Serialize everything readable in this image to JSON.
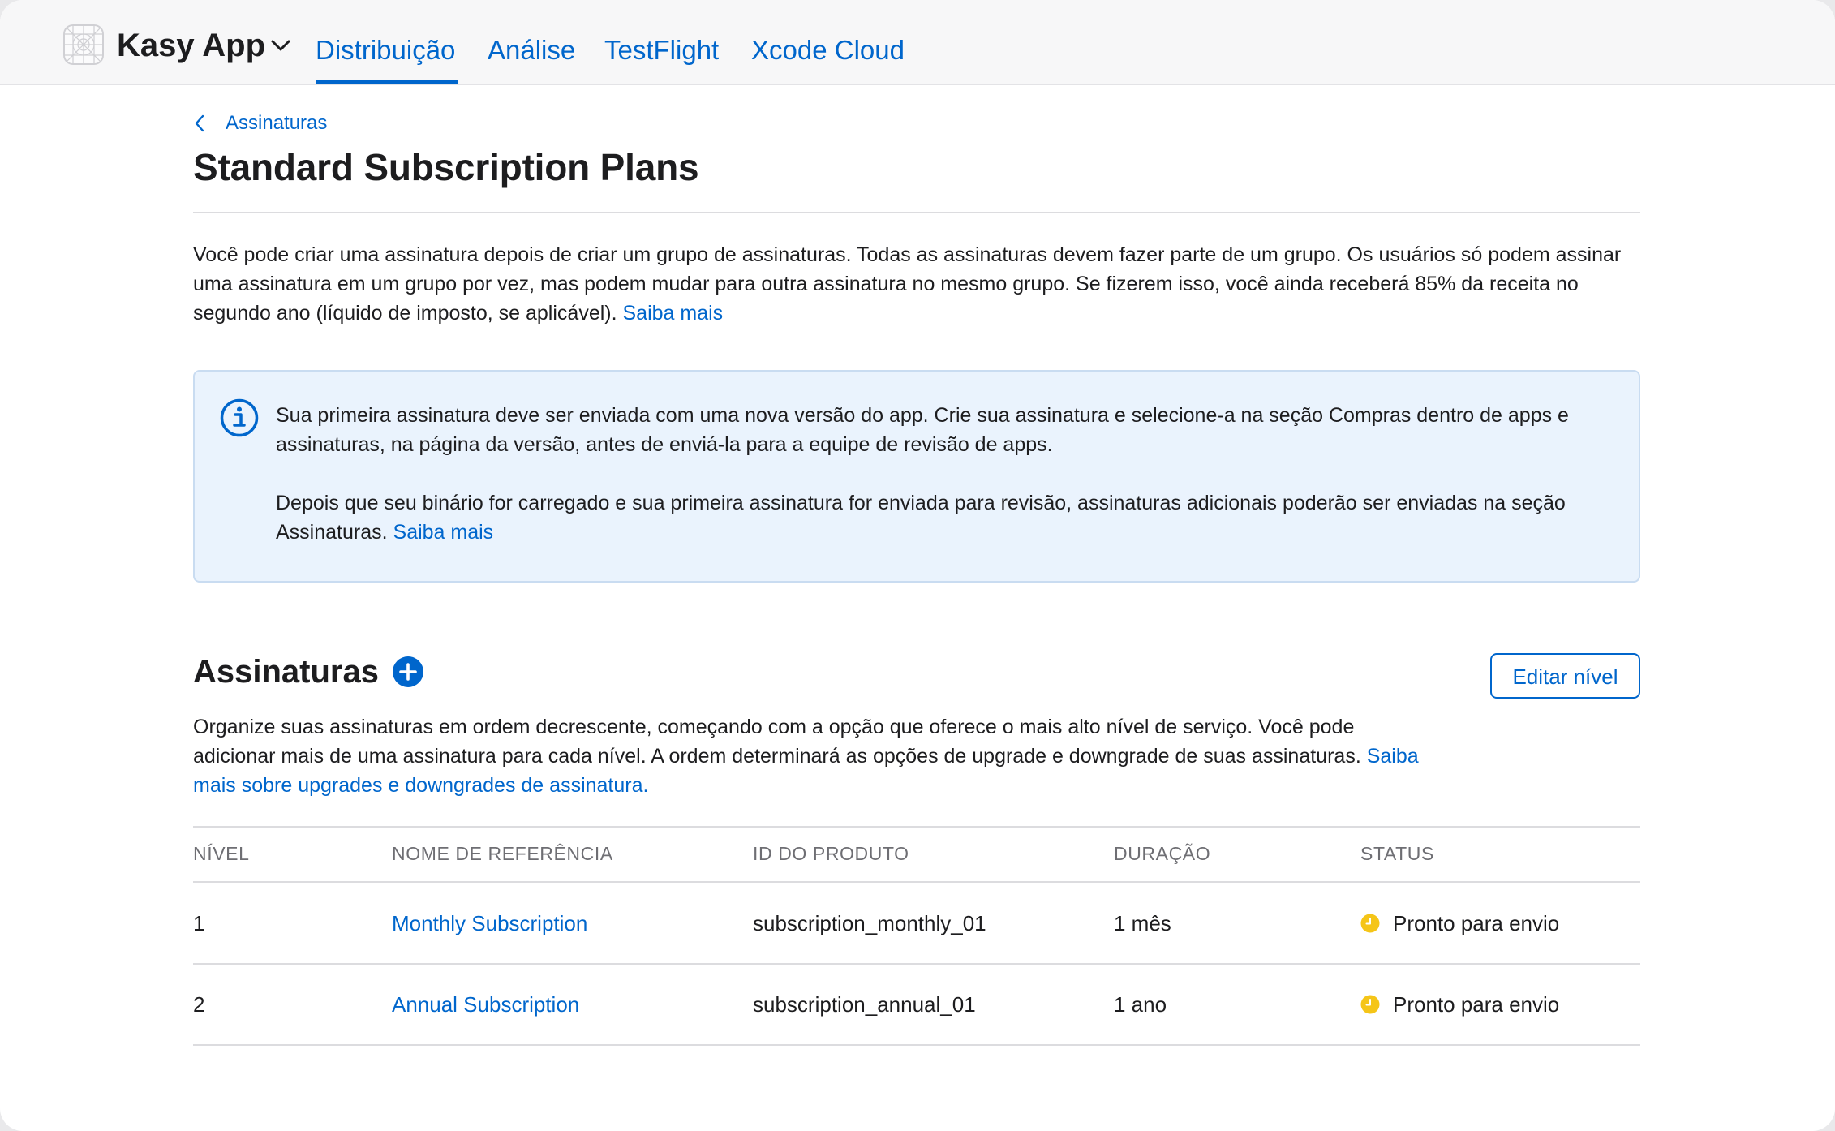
{
  "header": {
    "app_name": "Kasy App",
    "tabs": [
      {
        "label": "Distribuição",
        "active": true
      },
      {
        "label": "Análise",
        "active": false
      },
      {
        "label": "TestFlight",
        "active": false
      },
      {
        "label": "Xcode Cloud",
        "active": false
      }
    ]
  },
  "breadcrumb": {
    "label": "Assinaturas"
  },
  "page": {
    "title": "Standard Subscription Plans"
  },
  "intro": {
    "text": "Você pode criar uma assinatura depois de criar um grupo de assinaturas. Todas as assinaturas devem fazer parte de um grupo. Os usuários só podem assinar uma assinatura em um grupo por vez, mas podem mudar para outra assinatura no mesmo grupo. Se fizerem isso, você ainda receberá 85% da receita no segundo ano (líquido de imposto, se aplicável).",
    "link": "Saiba mais"
  },
  "info": {
    "paragraph1": "Sua primeira assinatura deve ser enviada com uma nova versão do app. Crie sua assinatura e selecione-a na seção Compras dentro de apps e assinaturas, na página da versão, antes de enviá-la para a equipe de revisão de apps.",
    "paragraph2": "Depois que seu binário for carregado e sua primeira assinatura for enviada para revisão, assinaturas adicionais poderão ser enviadas na seção Assinaturas.",
    "link": "Saiba mais"
  },
  "subscriptions": {
    "title": "Assinaturas",
    "edit_label": "Editar nível",
    "description": "Organize suas assinaturas em ordem decrescente, começando com a opção que oferece o mais alto nível de serviço. Você pode adicionar mais de uma assinatura para cada nível. A ordem determinará as opções de upgrade e downgrade de suas assinaturas.",
    "description_link": "Saiba mais sobre upgrades e downgrades de assinatura.",
    "columns": [
      "NÍVEL",
      "NOME DE REFERÊNCIA",
      "ID DO PRODUTO",
      "DURAÇÃO",
      "STATUS"
    ],
    "rows": [
      {
        "level": "1",
        "name": "Monthly Subscription",
        "product_id": "subscription_monthly_01",
        "duration": "1 mês",
        "status": "Pronto para envio"
      },
      {
        "level": "2",
        "name": "Annual Subscription",
        "product_id": "subscription_annual_01",
        "duration": "1 ano",
        "status": "Pronto para envio"
      }
    ]
  },
  "colors": {
    "accent": "#0066cc",
    "status_ready": "#f5c518",
    "info_bg": "#eaf3fd"
  },
  "icons": {
    "app": "app-placeholder-icon",
    "app_menu": "chevron-down-icon",
    "back": "chevron-left-icon",
    "info": "info-circle-icon",
    "add": "plus-circle-icon",
    "status": "clock-icon"
  }
}
